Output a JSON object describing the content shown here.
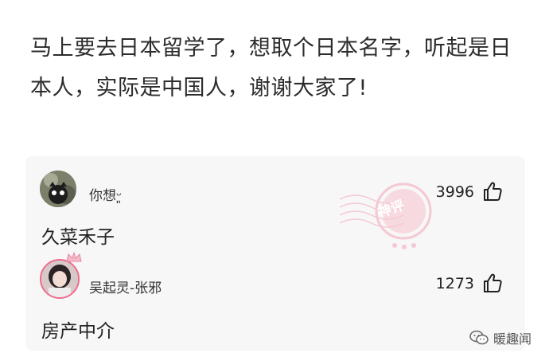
{
  "post": {
    "text_line1": "马上要去日本留学了，想取个日本名字，听起是日",
    "text_line2": "本人，实际是中国人，谢谢大家了!"
  },
  "comments": [
    {
      "username": "你想ᵕ͈",
      "likes": "3996",
      "body": "久菜禾子",
      "stamp_text": "神评"
    },
    {
      "username": "吴起灵-张邪",
      "likes": "1273",
      "body": "房产中介"
    }
  ],
  "watermark": {
    "text": "暖趣闻",
    "icon": "wechat-icon"
  },
  "colors": {
    "background": "#ffffff",
    "comment_panel": "#f7f7f7",
    "stamp_pink": "#f4a3b6",
    "avatar_ring": "#f06a8c"
  }
}
